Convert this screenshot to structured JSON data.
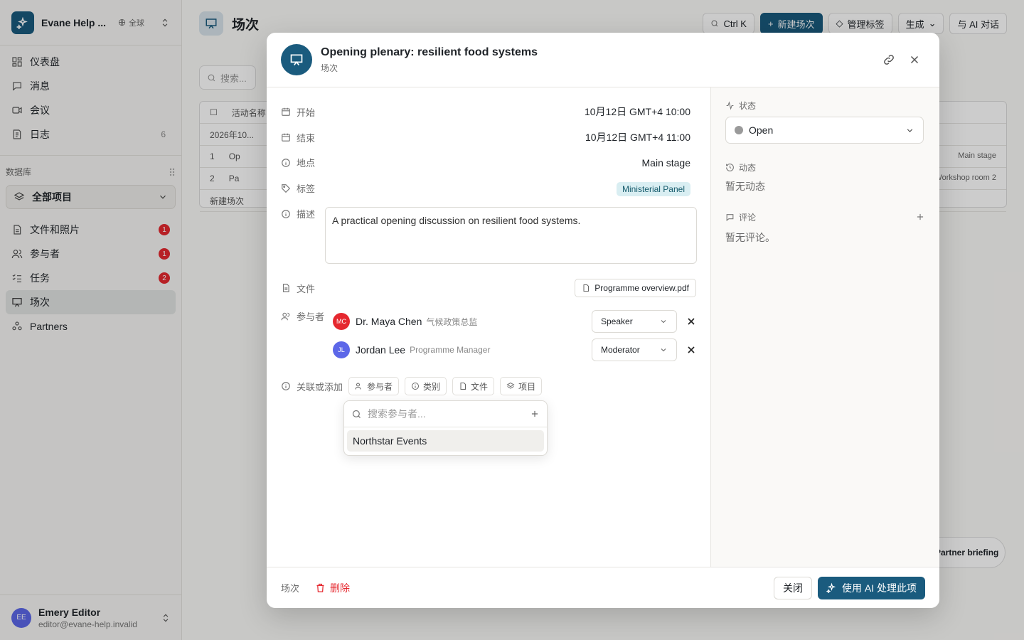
{
  "workspace": {
    "name": "Evane Help ...",
    "scope": "全球"
  },
  "sidebar": {
    "nav": [
      {
        "label": "仪表盘",
        "icon": "dashboard-icon"
      },
      {
        "label": "消息",
        "icon": "message-icon"
      },
      {
        "label": "会议",
        "icon": "video-icon"
      },
      {
        "label": "日志",
        "icon": "log-icon",
        "count": "6"
      }
    ],
    "section_label": "数据库",
    "db_select": "全部项目",
    "items": [
      {
        "label": "文件和照片",
        "badge": "1"
      },
      {
        "label": "参与者",
        "badge": "1"
      },
      {
        "label": "任务",
        "badge": "2"
      },
      {
        "label": "场次",
        "active": true
      },
      {
        "label": "Partners"
      }
    ]
  },
  "user": {
    "initials": "EE",
    "name": "Emery Editor",
    "email": "editor@evane-help.invalid"
  },
  "background": {
    "title": "场次",
    "shortcut": "Ctrl K",
    "new_btn": "新建场次",
    "tags_btn": "管理标签",
    "gen_btn": "生成",
    "ai_btn": "与 AI 对话",
    "search_placeholder": "搜索...",
    "col_name": "活动名称",
    "group": "2026年10...",
    "rows": [
      {
        "num": "1",
        "name": "Op",
        "loc": "Main stage"
      },
      {
        "num": "2",
        "name": "Pa",
        "loc": "Workshop room 2"
      }
    ],
    "new_row": "新建场次",
    "float_label": "Partner briefing"
  },
  "modal": {
    "title": "Opening plenary: resilient food systems",
    "subtitle": "场次",
    "fields": {
      "start_label": "开始",
      "start_value": "10月12日 GMT+4 10:00",
      "end_label": "结束",
      "end_value": "10月12日 GMT+4 11:00",
      "location_label": "地点",
      "location_value": "Main stage",
      "tags_label": "标签",
      "tag_value": "Ministerial Panel",
      "desc_label": "描述",
      "desc_value": "A practical opening discussion on resilient food systems.",
      "file_label": "文件",
      "file_value": "Programme overview.pdf",
      "participants_label": "参与者"
    },
    "participants": [
      {
        "initials": "MC",
        "name": "Dr. Maya Chen",
        "title": "气候政策总监",
        "role": "Speaker",
        "color": "#e5282f"
      },
      {
        "initials": "JL",
        "name": "Jordan Lee",
        "title": "Programme Manager",
        "role": "Moderator",
        "color": "#5c67e8"
      }
    ],
    "link_label": "关联或添加",
    "link_chips": [
      "参与者",
      "类别",
      "文件",
      "项目"
    ],
    "popover": {
      "placeholder": "搜索参与者...",
      "item": "Northstar Events"
    },
    "right": {
      "status_label": "状态",
      "status_value": "Open",
      "activity_label": "动态",
      "activity_empty": "暂无动态",
      "comments_label": "评论",
      "comments_empty": "暂无评论。"
    },
    "footer": {
      "type": "场次",
      "delete": "删除",
      "close": "关闭",
      "ai": "使用 AI 处理此项"
    }
  }
}
